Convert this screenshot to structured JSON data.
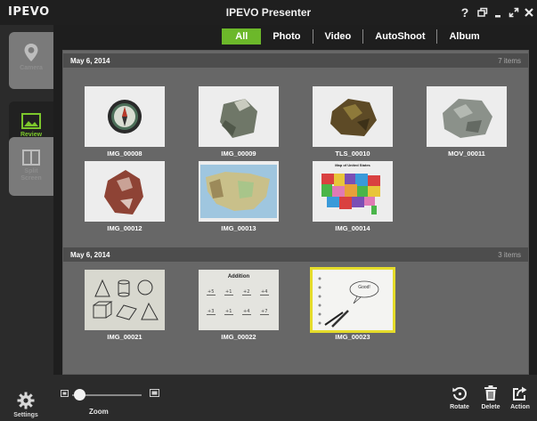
{
  "app": {
    "logo": "IPEVO",
    "title": "IPEVO Presenter"
  },
  "window_controls": [
    {
      "name": "help-button",
      "label": "?"
    },
    {
      "name": "window-mode-button",
      "icon": "windows-icon"
    },
    {
      "name": "minimize-button",
      "icon": "minimize-icon"
    },
    {
      "name": "maximize-button",
      "icon": "expand-icon"
    },
    {
      "name": "close-button",
      "icon": "close-icon"
    }
  ],
  "sidebar": {
    "camera": "Camera",
    "review": "Review",
    "split": "Split\nScreen",
    "settings": "Settings"
  },
  "tabs": [
    "All",
    "Photo",
    "Video",
    "AutoShoot",
    "Album"
  ],
  "groups": [
    {
      "date": "May 6, 2014",
      "count": "7 items",
      "items": [
        "IMG_00008",
        "IMG_00009",
        "TLS_00010",
        "MOV_00011",
        "IMG_00012",
        "IMG_00013",
        "IMG_00014"
      ]
    },
    {
      "date": "May 6, 2014",
      "count": "3 items",
      "items": [
        "IMG_00021",
        "IMG_00022",
        "IMG_00023"
      ]
    }
  ],
  "thumb_text": {
    "map_title": "Map of United States",
    "addition_title": "Addition",
    "speech": "Good!"
  },
  "bottom": {
    "zoom_label": "Zoom",
    "zoom_level": 0.03,
    "rotate": "Rotate",
    "delete": "Delete",
    "action": "Action"
  },
  "colors": {
    "accent": "#6cb82a",
    "selected": "#e5dc2a"
  }
}
